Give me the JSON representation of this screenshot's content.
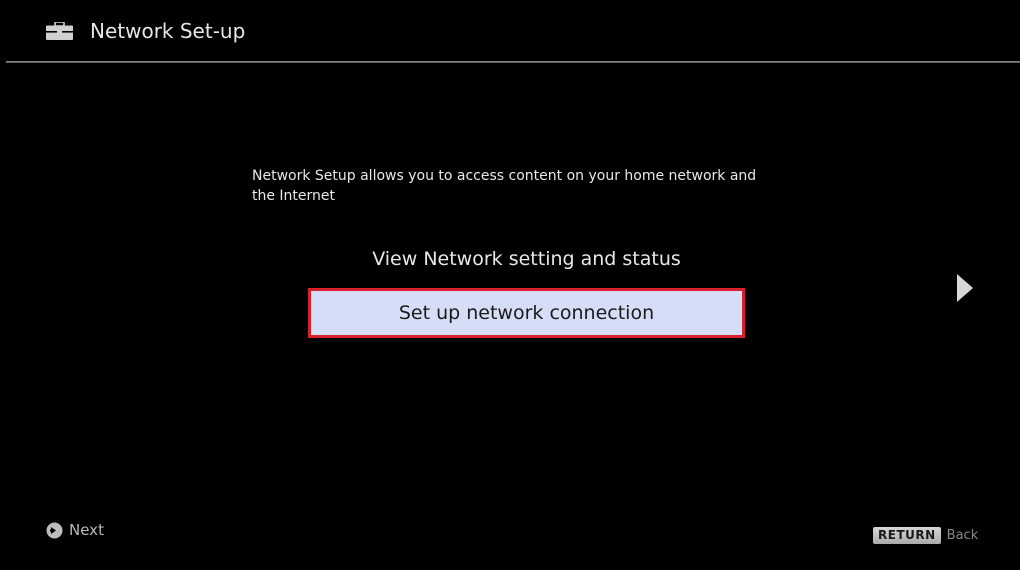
{
  "header": {
    "icon": "toolbox-icon",
    "title": "Network Set-up"
  },
  "main": {
    "description": "Network Setup allows you to access content on your home network and the Internet",
    "options": [
      {
        "label": "View Network setting and status",
        "selected": false
      },
      {
        "label": "Set up network connection",
        "selected": true
      }
    ],
    "next_arrow_icon": "chevron-right-icon"
  },
  "footer": {
    "next": {
      "icon": "circle-arrow-right-icon",
      "label": "Next"
    },
    "back": {
      "key_label": "RETURN",
      "label": "Back"
    }
  },
  "colors": {
    "background": "#000000",
    "selected_fill": "#d6ddf7",
    "selected_border": "#d8202a",
    "text": "#e8e8e8"
  }
}
